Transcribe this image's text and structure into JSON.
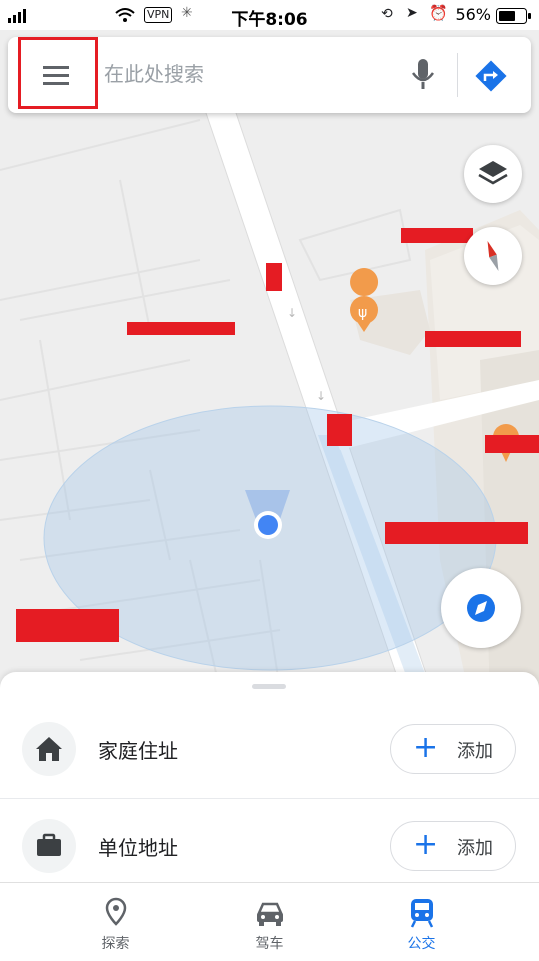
{
  "status_bar": {
    "vpn": "VPN",
    "time": "下午8:06",
    "battery": "56%"
  },
  "search": {
    "placeholder": "在此处搜索"
  },
  "icons": {
    "menu": "menu-icon",
    "mic": "microphone-icon",
    "directions": "directions-icon",
    "layers": "layers-icon",
    "compass": "compass-icon",
    "location": "my-location-icon",
    "home": "home-icon",
    "work": "briefcase-icon"
  },
  "saved_places": [
    {
      "label": "家庭住址",
      "action": "添加"
    },
    {
      "label": "单位地址",
      "action": "添加"
    }
  ],
  "tabs": [
    {
      "label": "探索",
      "active": false
    },
    {
      "label": "驾车",
      "active": false
    },
    {
      "label": "公交",
      "active": true
    }
  ],
  "colors": {
    "accent": "#1a73e8",
    "redaction": "#e51c23",
    "poi": "#f29b4b"
  }
}
